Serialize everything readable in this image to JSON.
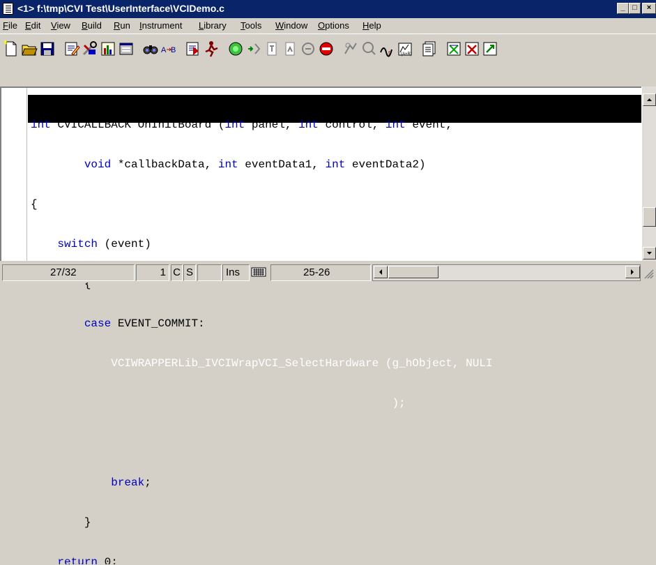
{
  "window": {
    "title": "<1> f:\\tmp\\CVI Test\\UserInterface\\VCIDemo.c",
    "minimize_glyph": "_",
    "maximize_glyph": "□",
    "close_glyph": "×"
  },
  "menu": {
    "items": [
      "File",
      "Edit",
      "View",
      "Build",
      "Run",
      "Instrument",
      "Library",
      "Tools",
      "Window",
      "Options",
      "Help"
    ]
  },
  "toolbar": {
    "buttons": [
      "new-icon",
      "open-icon",
      "save-icon",
      "edit-icon",
      "tools-icon",
      "chart-icon",
      "panel-icon",
      "find-icon",
      "replace-icon",
      "goto-icon",
      "run-icon",
      "debug-icon",
      "bookmark-icon",
      "prev-icon",
      "next-icon",
      "step-icon",
      "breakpoint-icon",
      "watch-icon",
      "variables-icon",
      "memory-icon",
      "function-icon",
      "project-icon",
      "compile-icon",
      "close-all-icon",
      "tile-icon"
    ]
  },
  "code": {
    "lines": [
      {
        "text": "int CVICALLBACK OnInitBoard (int panel, int control, int event,"
      },
      {
        "text": "        void *callbackData, int eventData1, int eventData2)"
      },
      {
        "text": "{"
      },
      {
        "text": "    switch (event)"
      },
      {
        "text": "        {"
      },
      {
        "text": "        case EVENT_COMMIT:"
      },
      {
        "text": "            VCIWRAPPERLib_IVCIWrapVCI_SelectHardware (g_hObject, NULI"
      },
      {
        "text": "                                                      );"
      },
      {
        "text": ""
      },
      {
        "text": "            break;"
      },
      {
        "text": "        }"
      },
      {
        "text": "    return 0;"
      }
    ]
  },
  "status": {
    "line_position": "27/32",
    "column": "1",
    "c_flag": "C",
    "s_flag": "S",
    "insert_mode": "Ins",
    "range": "25-26"
  }
}
